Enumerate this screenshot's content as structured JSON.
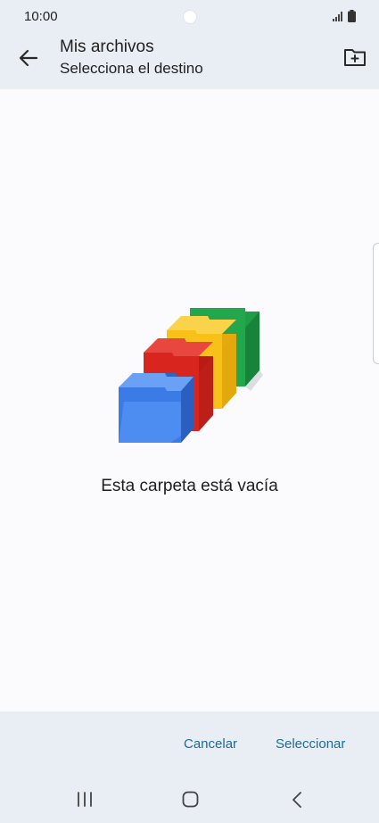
{
  "status_bar": {
    "time": "10:00",
    "icons": [
      "signal-icon",
      "battery-icon"
    ]
  },
  "app_bar": {
    "title": "Mis archivos",
    "subtitle": "Selecciona el destino",
    "back_icon": "arrow-left-icon",
    "new_folder_icon": "create-folder-icon"
  },
  "content": {
    "empty_message": "Esta carpeta está vacía",
    "illustration": "empty-folders-illustration"
  },
  "actions": {
    "cancel_label": "Cancelar",
    "select_label": "Seleccionar"
  },
  "nav_bar": {
    "icons": [
      "recents-icon",
      "home-icon",
      "back-icon"
    ]
  },
  "colors": {
    "app_background": "#e8eef4",
    "content_background": "#fbfbfe",
    "accent": "#1a6b9a",
    "folder_blue": "#3b7be6",
    "folder_red": "#d8251d",
    "folder_yellow": "#f7c11a",
    "folder_green": "#1f9d47"
  }
}
